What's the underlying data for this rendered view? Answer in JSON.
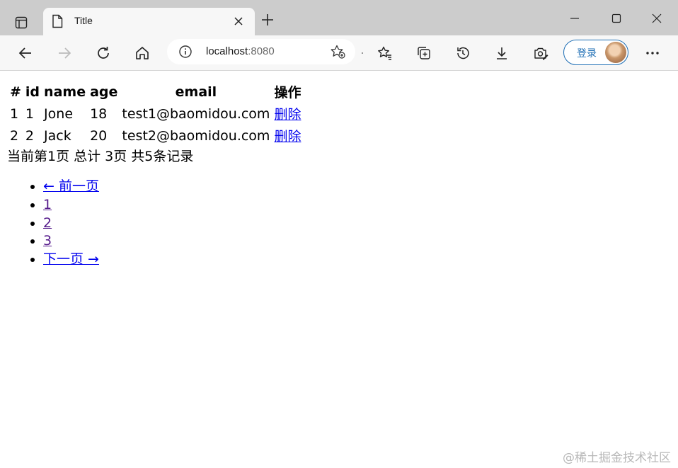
{
  "browser": {
    "tab_title": "Title",
    "url_host": "localhost",
    "url_port": ":8080",
    "login_label": "登录"
  },
  "table": {
    "headers": [
      "#",
      "id",
      "name",
      "age",
      "email",
      "操作"
    ],
    "rows": [
      {
        "index": "1",
        "id": "1",
        "name": "Jone",
        "age": "18",
        "email": "test1@baomidou.com",
        "action": "删除"
      },
      {
        "index": "2",
        "id": "2",
        "name": "Jack",
        "age": "20",
        "email": "test2@baomidou.com",
        "action": "删除"
      }
    ]
  },
  "page_info": "当前第1页 总计 3页 共5条记录",
  "pagination": {
    "prev": "← 前一页",
    "pages": [
      "1",
      "2",
      "3"
    ],
    "next": "下一页 →"
  },
  "watermark": "@稀土掘金技术社区",
  "colors": {
    "link": "#0000ee",
    "visited_link": "#551a8b",
    "accent": "#1f6fb5"
  }
}
